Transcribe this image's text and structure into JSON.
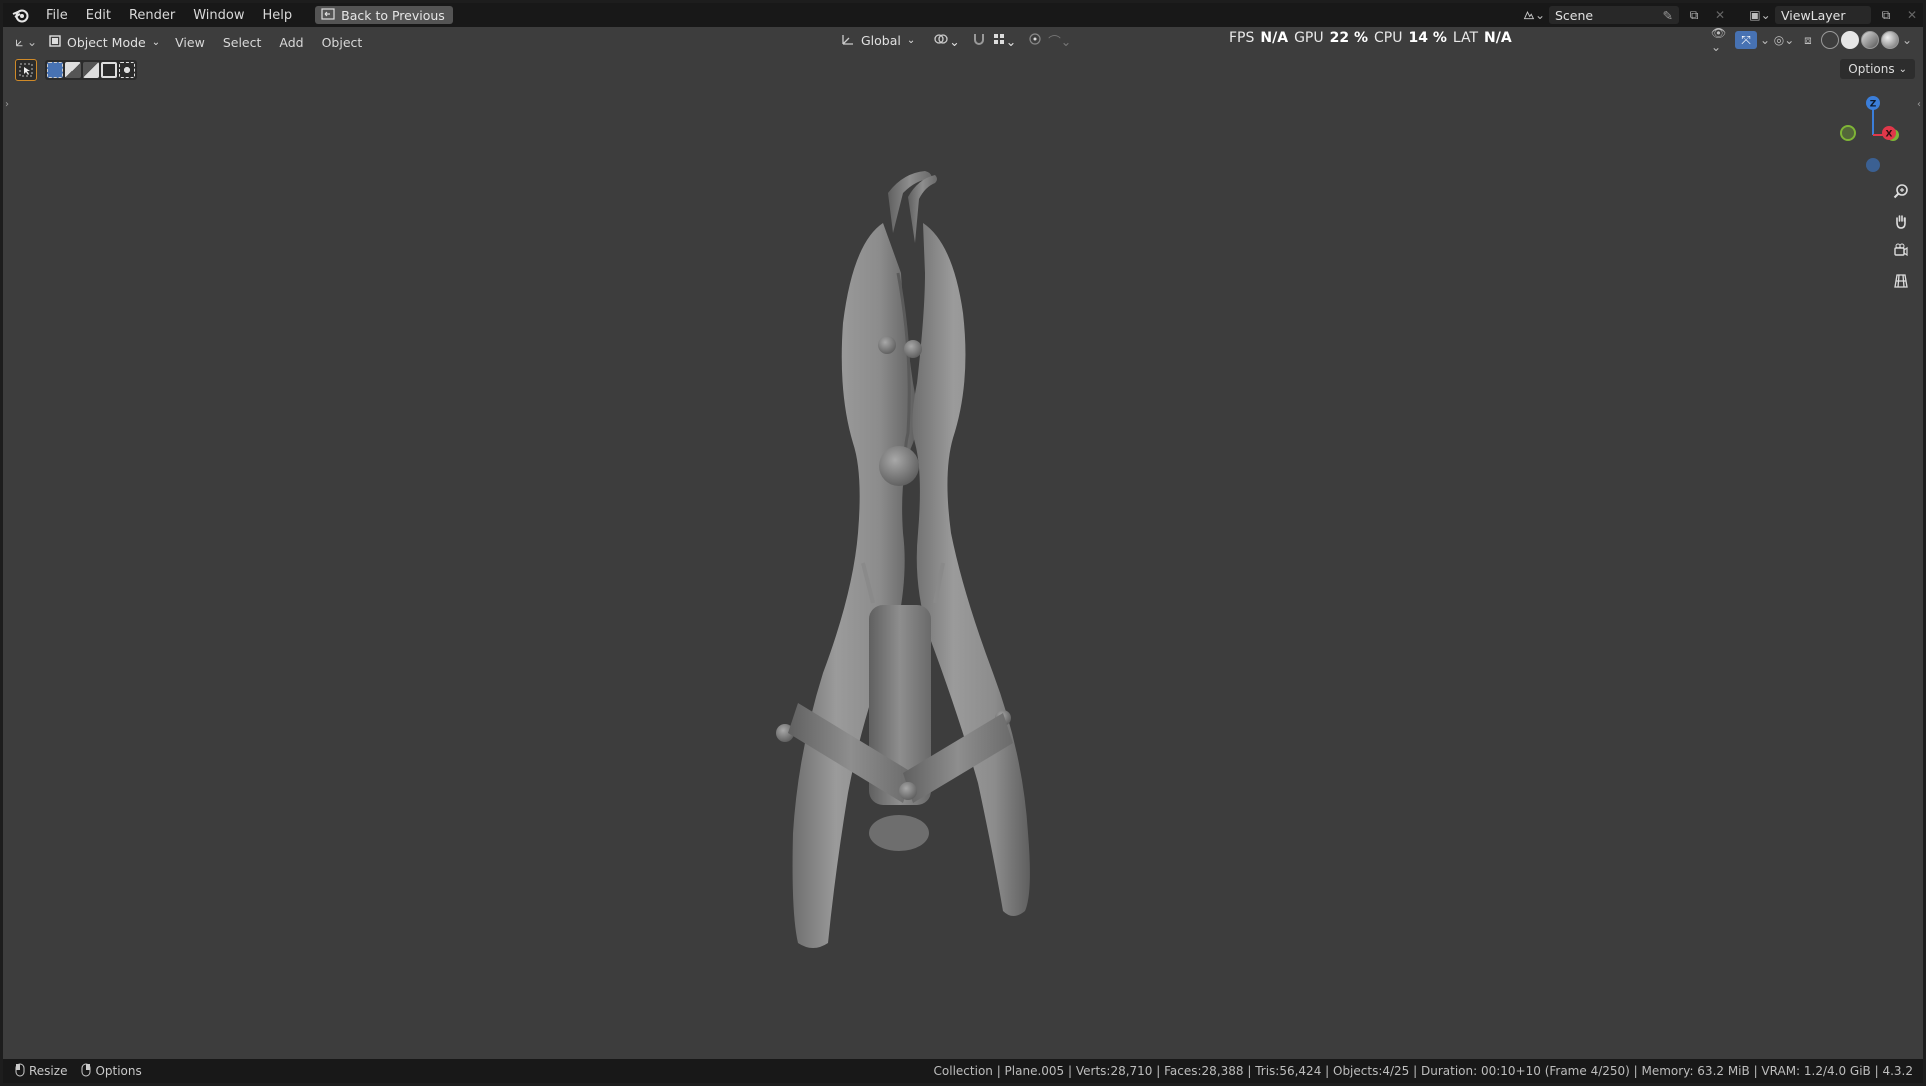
{
  "topbar": {
    "menus": [
      "File",
      "Edit",
      "Render",
      "Window",
      "Help"
    ],
    "back_label": "Back to Previous",
    "scene_label": "Scene",
    "viewlayer_label": "ViewLayer"
  },
  "viewport_header": {
    "mode_label": "Object Mode",
    "menus": [
      "View",
      "Select",
      "Add",
      "Object"
    ],
    "orientation_label": "Global",
    "stats": {
      "fps_label": "FPS",
      "fps_value": "N/A",
      "gpu_label": "GPU",
      "gpu_value": "22 %",
      "cpu_label": "CPU",
      "cpu_value": "14 %",
      "lat_label": "LAT",
      "lat_value": "N/A"
    }
  },
  "toolbar": {
    "options_label": "Options"
  },
  "gizmo": {
    "z_label": "Z",
    "x_label": "X",
    "colors": {
      "x": "#e0384a",
      "y": "#7fb536",
      "z": "#3b7ed9"
    }
  },
  "statusbar": {
    "resize_label": "Resize",
    "options_label": "Options",
    "info": "Collection | Plane.005 | Verts:28,710 | Faces:28,388 | Tris:56,424 | Objects:4/25 | Duration: 00:10+10 (Frame 4/250) | Memory: 63.2 MiB | VRAM: 1.2/4.0 GiB | 4.3.2"
  },
  "icons": [
    "blender-logo-icon",
    "back-icon",
    "scene-icon",
    "viewlayer-icon",
    "editor-type-icon",
    "object-mode-icon",
    "orientation-icon",
    "pivot-icon",
    "snap-icon",
    "proportional-icon",
    "visibility-icon",
    "gizmo-toggle-icon",
    "overlay-icon",
    "xray-icon",
    "wireframe-shading-icon",
    "solid-shading-icon",
    "material-shading-icon",
    "rendered-shading-icon",
    "select-box-icon",
    "zoom-icon",
    "pan-hand-icon",
    "camera-view-icon",
    "ortho-grid-icon",
    "mouse-icon"
  ]
}
